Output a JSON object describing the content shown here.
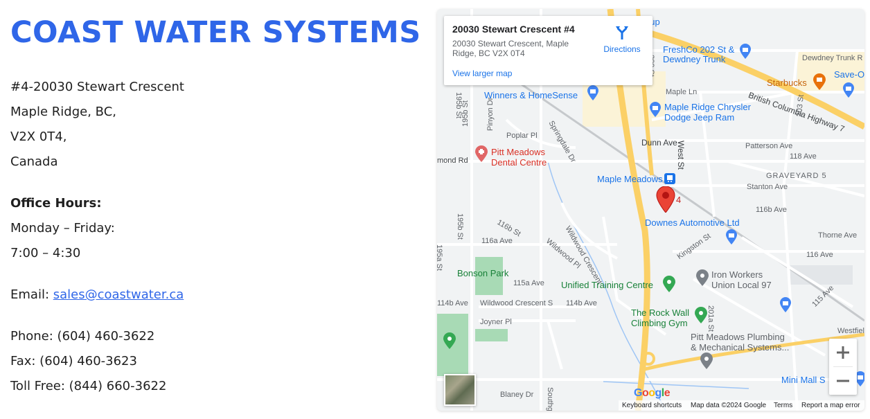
{
  "company": {
    "name": "COAST WATER SYSTEMS",
    "address": [
      "#4-20030 Stewart Crescent",
      "Maple Ridge, BC,",
      "V2X 0T4,",
      "Canada"
    ],
    "hours_label": "Office Hours:",
    "hours_days": "Monday – Friday:",
    "hours_time": "7:00 – 4:30",
    "email_label": "Email: ",
    "email": "sales@coastwater.ca",
    "phone": "Phone: (604) 460-3622",
    "fax": "Fax: (604) 460-3623",
    "toll_free": "Toll Free:  (844) 660-3622"
  },
  "map": {
    "card": {
      "title": "20030 Stewart Crescent #4",
      "address": "20030 Stewart Crescent, Maple Ridge, BC V2X 0T4",
      "view_larger": "View larger map",
      "directions": "Directions"
    },
    "marker_label": "4",
    "streets": {
      "dewdney": "Dewdney Trunk R",
      "bc_hwy": "British Columbia Highway 7",
      "maple_ln": "Maple Ln",
      "poplar": "Poplar Pl",
      "pinyon": "Pinyon Dr",
      "springdale": "Springdale Dr",
      "s195b": "195b St",
      "dunn": "Dunn Ave",
      "west": "West St",
      "patterson": "Patterson Ave",
      "ave118": "118 Ave",
      "s203": "203 St",
      "graveyard": "GRAVEYARD 5",
      "stanton": "Stanton Ave",
      "ave116b": "116b Ave",
      "thorne": "Thorne Ave",
      "ave116": "116 Ave",
      "raymond": "mond Rd",
      "s195b2": "195b St",
      "s116b": "116b St",
      "ave116a": "116a Ave",
      "wildwood_pl": "Wildwood Pl",
      "wildwood_cres": "Wildwood Crescent",
      "s195a": "195a St",
      "kingston": "Kingston St",
      "ave115a": "115a Ave",
      "ave114b": "114b Ave",
      "ave114b2": "114b Ave",
      "wildwood_cres_s": "Wildwood Crescent S",
      "joyner": "Joyner Pl",
      "s201a": "201a St",
      "ave115": "115 Ave",
      "westfiel": "Westfiel",
      "blaney": "Blaney Dr",
      "south": "Southg",
      "s200": "200 St",
      "s195": "195b St"
    },
    "pois": {
      "group": "oup",
      "freshco": [
        "FreshCo 202 St &",
        "Dewdney Trunk"
      ],
      "save_on": "Save-O",
      "starbucks": "Starbucks",
      "winners": "Winners & HomeSense",
      "chrysler": [
        "Maple Ridge Chrysler",
        "Dodge Jeep Ram"
      ],
      "dental": [
        "Pitt Meadows",
        "Dental Centre"
      ],
      "station": "Maple Meadows",
      "downes": "Downes Automotive Ltd",
      "bonson": "Bonson Park",
      "ironworkers": [
        "Iron Workers",
        "Union Local 97"
      ],
      "unified": "Unified Training Centre",
      "rockwall": [
        "The Rock Wall",
        "Climbing Gym"
      ],
      "plumbing": [
        "Pitt Meadows Plumbing",
        "& Mechanical Systems..."
      ],
      "minimall": "Mini Mall S"
    },
    "attribution": {
      "keyboard": "Keyboard shortcuts",
      "data": "Map data ©2024 Google",
      "terms": "Terms",
      "report": "Report a map error"
    },
    "google_logo": "Google",
    "zoom_in": "+",
    "zoom_out": "−",
    "icons": [
      "directions-icon",
      "zoom-in-icon",
      "zoom-out-icon",
      "location-pin-icon",
      "shopping-bag-icon",
      "coffee-cup-icon",
      "train-icon",
      "tree-icon",
      "medical-icon",
      "gym-icon"
    ],
    "colors": {
      "brand": "#2f66e8",
      "highway": "#fbd066",
      "water": "#9ec5f5",
      "park": "#a8dab5",
      "pin_red": "#ea4335"
    }
  }
}
